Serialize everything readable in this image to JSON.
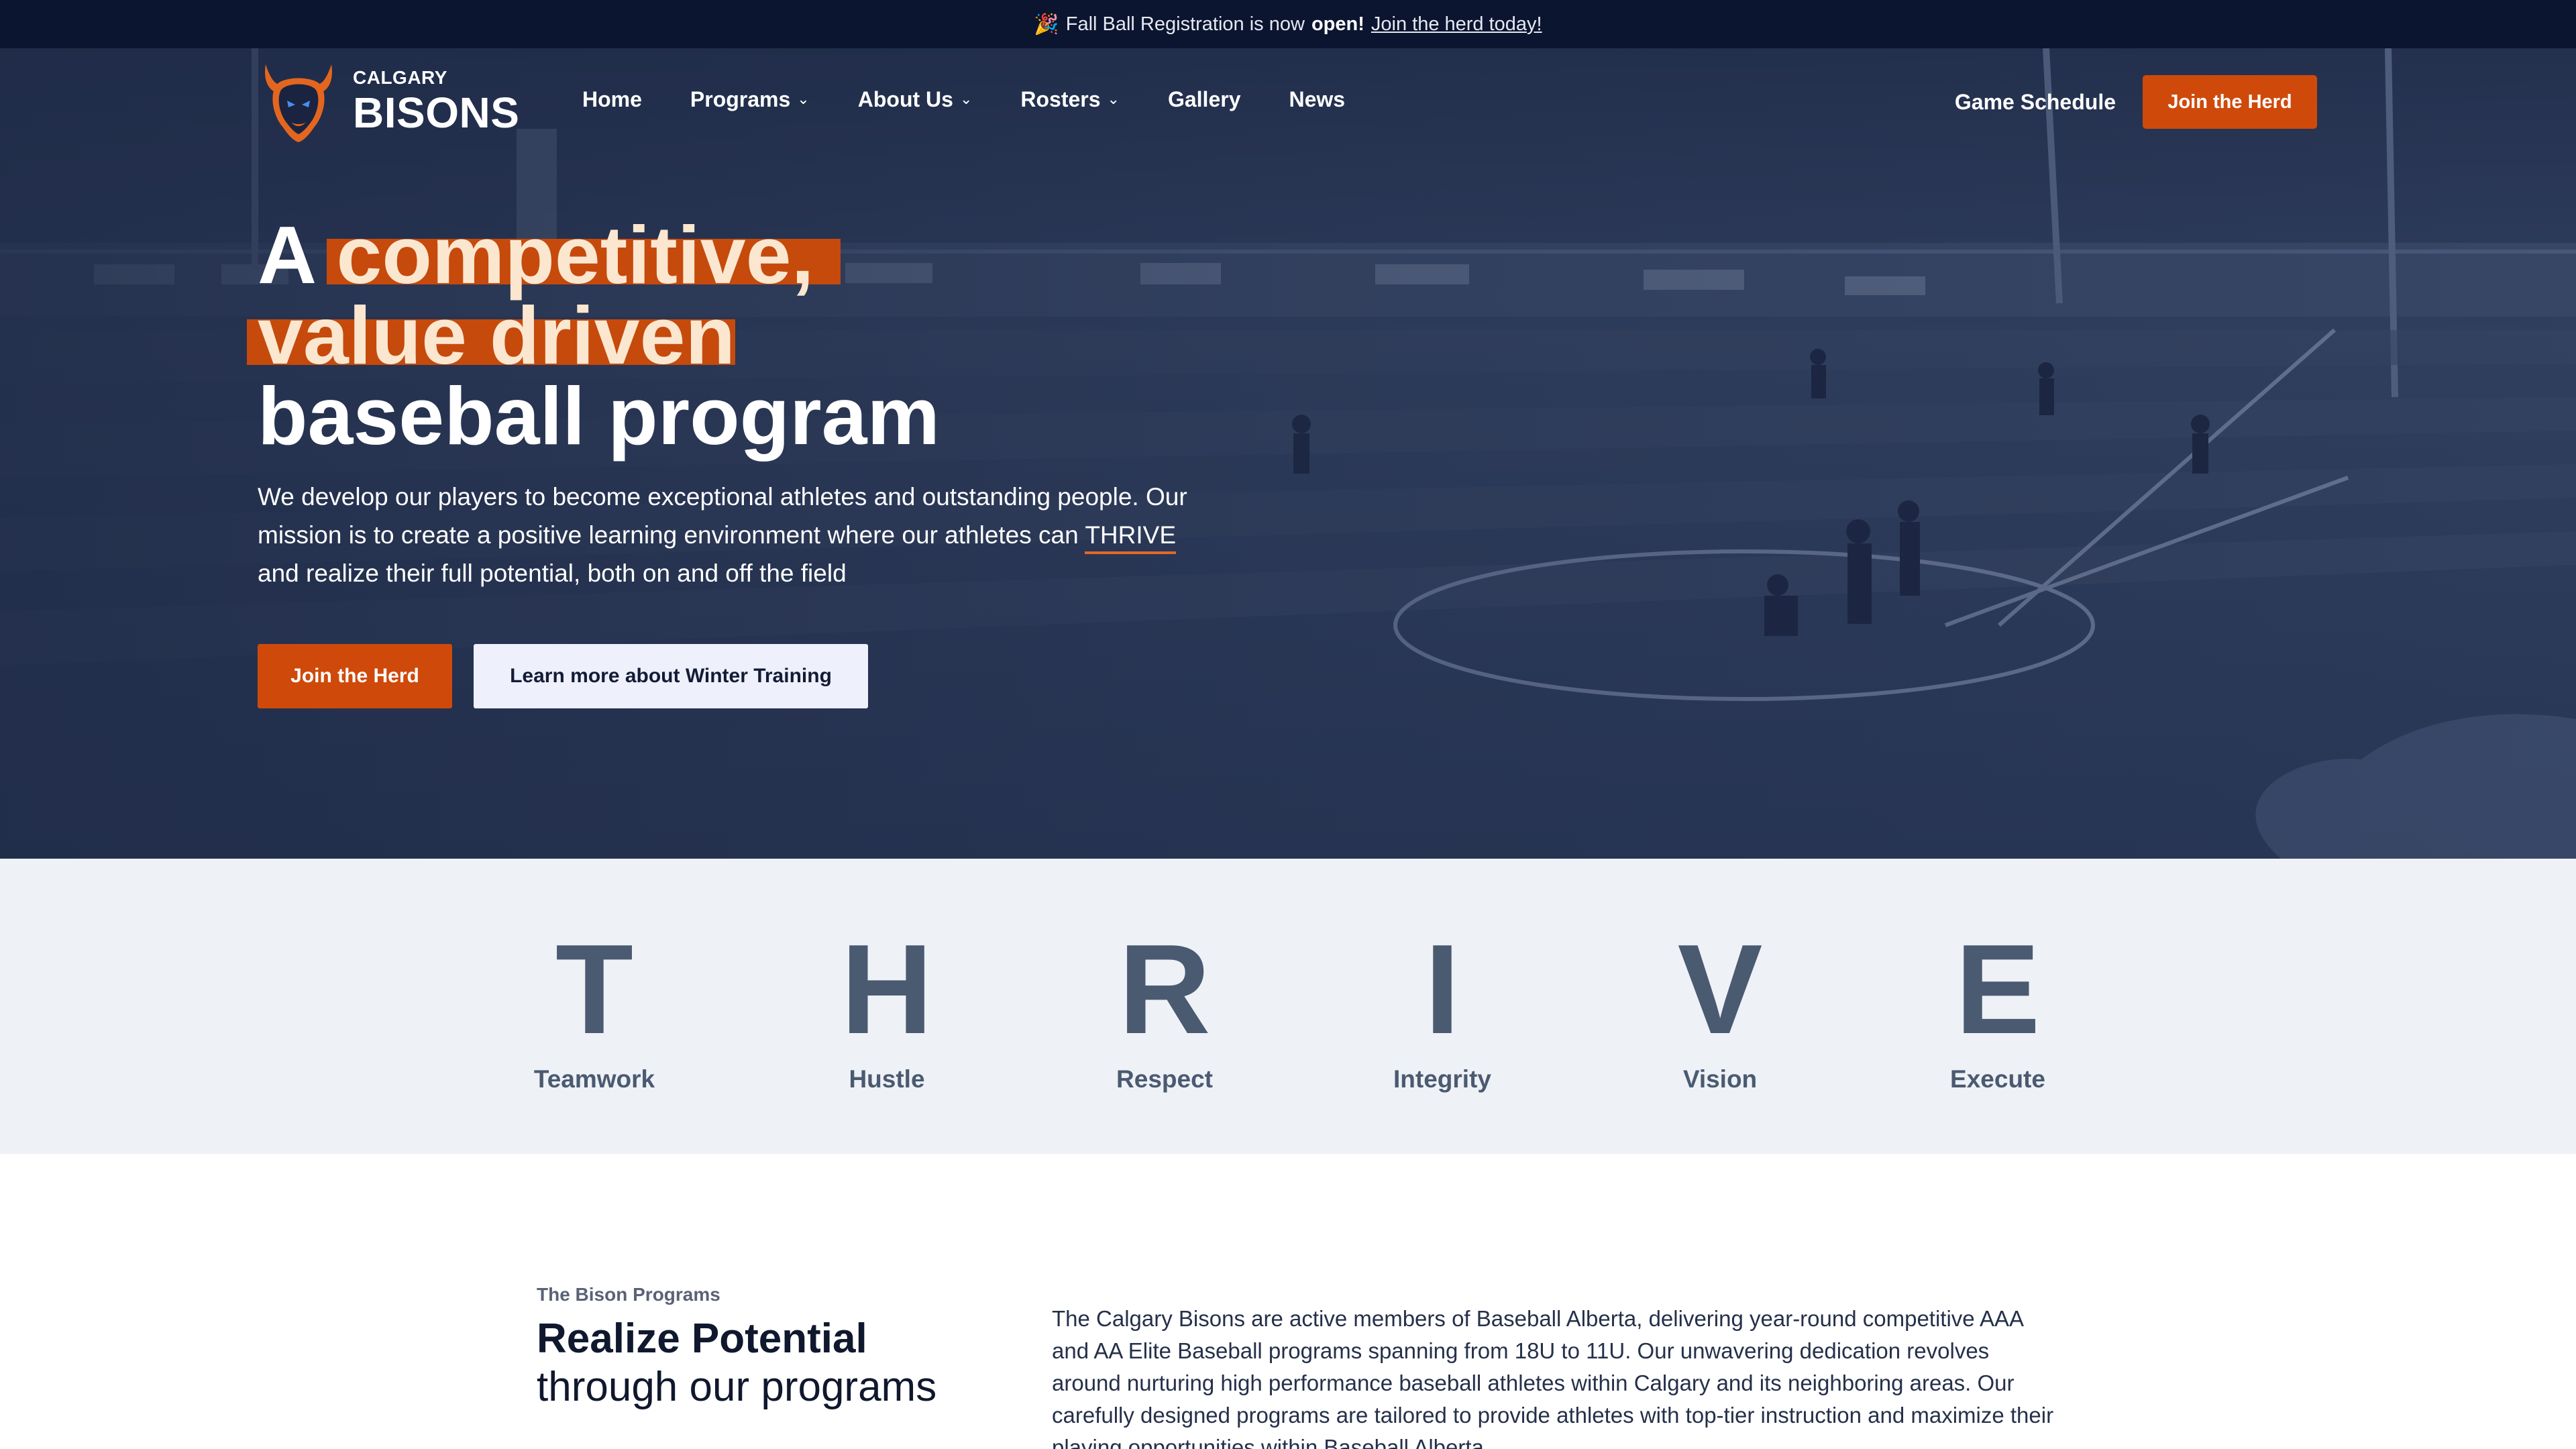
{
  "announcement": {
    "icon": "party-popper-icon",
    "text_before": "Fall Ball Registration is now",
    "text_bold": "open!",
    "link": "Join the herd today!"
  },
  "logo": {
    "city": "CALGARY",
    "name": "BISONS"
  },
  "nav": {
    "items": [
      {
        "label": "Home",
        "dropdown": false
      },
      {
        "label": "Programs",
        "dropdown": true
      },
      {
        "label": "About Us",
        "dropdown": true
      },
      {
        "label": "Rosters",
        "dropdown": true
      },
      {
        "label": "Gallery",
        "dropdown": false
      },
      {
        "label": "News",
        "dropdown": false
      }
    ],
    "chevron": "⌄",
    "schedule": "Game Schedule",
    "cta": "Join the Herd"
  },
  "hero": {
    "title_a": "A",
    "title_hl1": "competitive,",
    "title_hl2": "value driven",
    "title_line3": "baseball program",
    "desc_before": "We develop our players to become exceptional athletes and outstanding people. Our mission is to create a positive learning environment where our athletes can",
    "desc_thrive": "THRIVE",
    "desc_after": "and realize their full potential, both on and off the field",
    "btn_primary": "Join the Herd",
    "btn_secondary": "Learn more about Winter Training"
  },
  "thrive": [
    {
      "letter": "T",
      "label": "Teamwork"
    },
    {
      "letter": "H",
      "label": "Hustle"
    },
    {
      "letter": "R",
      "label": "Respect"
    },
    {
      "letter": "I",
      "label": "Integrity"
    },
    {
      "letter": "V",
      "label": "Vision"
    },
    {
      "letter": "E",
      "label": "Execute"
    }
  ],
  "programs": {
    "eyebrow": "The Bison Programs",
    "title_strong": "Realize Potential",
    "title_regular": "through our programs",
    "body": "The Calgary Bisons are active members of Baseball Alberta, delivering year-round competitive AAA and AA Elite Baseball programs spanning from 18U to 11U. Our unwavering dedication revolves around nurturing high performance baseball athletes within Calgary and its neighboring areas. Our carefully designed programs are tailored to provide athletes with top-tier instruction and maximize their playing opportunities within Baseball Alberta."
  },
  "colors": {
    "accent": "#cf4a0a",
    "navy": "#0b1530",
    "hero_overlay": "#2b3a5c",
    "thrive_text": "#4a5a71"
  }
}
